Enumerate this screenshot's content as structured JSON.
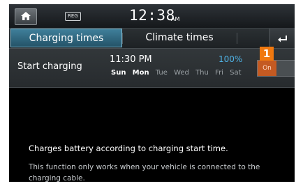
{
  "status": {
    "home_icon": "home-icon",
    "reg_badge": "REG",
    "clock": "12:38",
    "ampm": "AM"
  },
  "tabs": [
    {
      "label": "Charging times",
      "active": true
    },
    {
      "label": "Climate times",
      "active": false
    }
  ],
  "back_icon": "back-arrow-icon",
  "schedule": {
    "label": "Start charging",
    "time": "11:30 PM",
    "percent": "100%",
    "days": [
      {
        "label": "Sun",
        "selected": true
      },
      {
        "label": "Mon",
        "selected": true
      },
      {
        "label": "Tue",
        "selected": false
      },
      {
        "label": "Wed",
        "selected": false
      },
      {
        "label": "Thu",
        "selected": false
      },
      {
        "label": "Fri",
        "selected": false
      },
      {
        "label": "Sat",
        "selected": false
      }
    ],
    "toggle_label": "On",
    "callout_number": "1"
  },
  "description": {
    "primary": "Charges battery according to charging start time.",
    "secondary": "This function only works when your vehicle is connected to the charging cable."
  },
  "colors": {
    "accent": "#4fb3e6",
    "toggle_on": "#c45a22",
    "callout": "#f0780f"
  }
}
